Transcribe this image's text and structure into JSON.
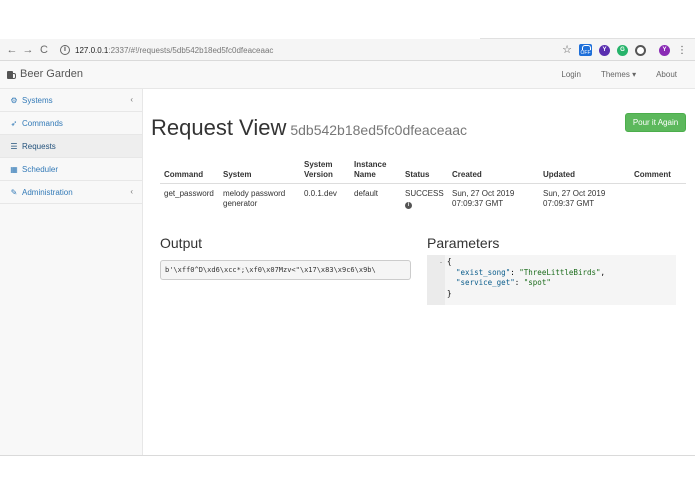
{
  "browser": {
    "url_host": "127.0.0.1",
    "url_path": ":2337/#!/requests/5db542b18ed5fc0dfeaceaac",
    "ext_off_label": "OFF",
    "profile_initial": "Y",
    "ext_y_initial": "Y",
    "ext_g_initial": "G"
  },
  "navbar": {
    "brand": "Beer Garden",
    "login": "Login",
    "themes": "Themes ▾",
    "about": "About"
  },
  "sidebar": {
    "items": [
      {
        "label": "Systems",
        "icon": "cogs-icon",
        "chevron": "‹"
      },
      {
        "label": "Commands",
        "icon": "rocket-icon"
      },
      {
        "label": "Requests",
        "icon": "list-icon"
      },
      {
        "label": "Scheduler",
        "icon": "calendar-icon"
      },
      {
        "label": "Administration",
        "icon": "wrench-icon",
        "chevron": "‹"
      }
    ]
  },
  "page": {
    "title": "Request View",
    "request_id": "5db542b18ed5fc0dfeaceaac",
    "pour_button": "Pour it Again"
  },
  "table": {
    "headers": {
      "command": "Command",
      "system": "System",
      "system_version": "System Version",
      "instance_name": "Instance Name",
      "status": "Status",
      "created": "Created",
      "updated": "Updated",
      "comment": "Comment"
    },
    "row": {
      "command": "get_password",
      "system": "melody password generator",
      "system_version": "0.0.1.dev",
      "instance_name": "default",
      "status": "SUCCESS",
      "created": "Sun, 27 Oct 2019 07:09:37 GMT",
      "updated": "Sun, 27 Oct 2019 07:09:37 GMT",
      "comment": ""
    }
  },
  "output": {
    "title": "Output",
    "value": "b'\\xff0^D\\xd6\\xcc*;\\xf0\\x07Mzv<\"\\x17\\x83\\x9c6\\x9b\\"
  },
  "parameters": {
    "title": "Parameters",
    "fold_marker": "-",
    "open_brace": "{",
    "close_brace": "}",
    "key1": "\"exist_song\"",
    "val1": "\"ThreeLittleBirds\"",
    "key2": "\"service_get\"",
    "val2": "\"spot\""
  },
  "colors": {
    "success_button": "#5cb85c",
    "link": "#337ab7"
  }
}
